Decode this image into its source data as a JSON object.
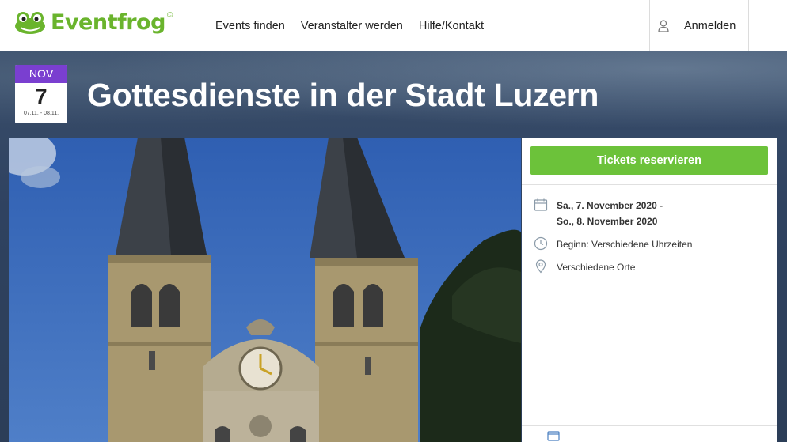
{
  "header": {
    "logo_text": "Eventfrog",
    "logo_mark": "©",
    "nav": [
      "Events finden",
      "Veranstalter werden",
      "Hilfe/Kontakt"
    ],
    "login_label": "Anmelden"
  },
  "event": {
    "month": "NOV",
    "day": "7",
    "date_range": "07.11. - 08.11.",
    "title": "Gottesdienste in der Stadt Luzern"
  },
  "info": {
    "ticket_button": "Tickets reservieren",
    "date_line1": "Sa., 7. November 2020 -",
    "date_line2": "So., 8. November 2020",
    "time": "Beginn: Verschiedene Uhrzeiten",
    "location": "Verschiedene Orte"
  },
  "icons": {
    "user": "user-icon",
    "calendar": "calendar-icon",
    "clock": "clock-icon",
    "location": "location-pin-icon"
  },
  "colors": {
    "brand_green": "#6ab42d",
    "button_green": "#6cc23a",
    "month_purple": "#7a3fd0"
  }
}
